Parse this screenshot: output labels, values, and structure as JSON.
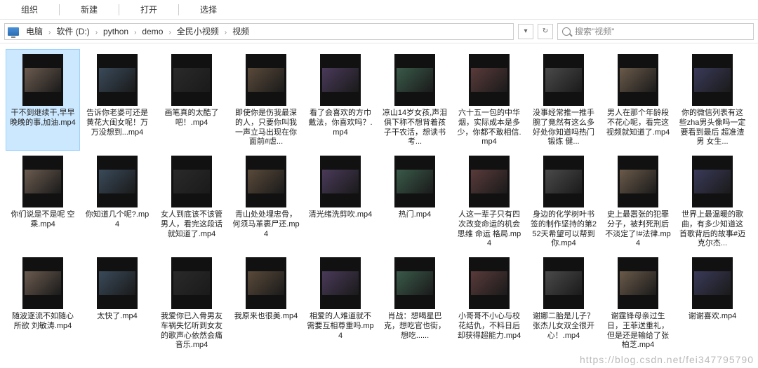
{
  "toolbar": {
    "organize": "组织",
    "new": "新建",
    "open": "打开",
    "select": "选择"
  },
  "breadcrumb": {
    "items": [
      "电脑",
      "软件 (D:)",
      "python",
      "demo",
      "全民小视频",
      "视频"
    ]
  },
  "navbuttons": {
    "refresh": "↻",
    "down": "▾"
  },
  "search": {
    "placeholder": "搜索\"视频\""
  },
  "files": [
    {
      "name": "干不到继续干,早早晚晚的事,加油.mp4",
      "selected": true
    },
    {
      "name": "告诉你老婆可还是黄花大闺女呢！万万没想到...mp4"
    },
    {
      "name": "画笔真的太酷了吧！.mp4"
    },
    {
      "name": "即使你是伤我最深的人，只要你叫我一声立马出现在你面前#虐..."
    },
    {
      "name": "看了会喜欢的方巾戴法，你喜欢吗？.mp4"
    },
    {
      "name": "凉山14岁女孩,声泪俱下称不想背着孩子干农活，想读书考..."
    },
    {
      "name": "六十五一包的中华烟，实际成本是多少，你都不敢相信.mp4"
    },
    {
      "name": "没事经常推一推手腕了竟然有这么多好处你知道吗热门 锻炼 健..."
    },
    {
      "name": "男人在那个年龄段不花心呢，看完这视频就知道了.mp4"
    },
    {
      "name": "你的微信列表有这些zha男头像吗一定要看到最后 超准渣男 女生..."
    },
    {
      "name": "你们说是不是呢 空乘.mp4"
    },
    {
      "name": "你知道几个呢?.mp4"
    },
    {
      "name": "女人到底该不该管男人，看完这段话就知道了.mp4"
    },
    {
      "name": "青山处处埋忠骨，何须马革裹尸还.mp4"
    },
    {
      "name": "清光绪洗剪吹.mp4"
    },
    {
      "name": "热门.mp4"
    },
    {
      "name": "人这一辈子只有四次改变命运的机会思维 命运 格局.mp4"
    },
    {
      "name": "身边的化学树叶书签的制作坚持的第252天希望可以帮到你.mp4"
    },
    {
      "name": "史上最嚣张的犯罪分子，被判死刑后不淡定了!#法律.mp4"
    },
    {
      "name": "世界上最温暖的歌曲，有多少知道这首歌背后的故事#迈克尔杰..."
    },
    {
      "name": "随波逐流不如随心所欲 刘敏涛.mp4"
    },
    {
      "name": "太快了.mp4"
    },
    {
      "name": "我爱你已入骨男友车祸失忆听到女友的歌声心依然会痛音乐.mp4"
    },
    {
      "name": "我原来也很美.mp4"
    },
    {
      "name": "相爱的人难道就不需要互相尊重吗.mp4"
    },
    {
      "name": "肖战：想喝星巴克，想吃官也街，想吃......"
    },
    {
      "name": "小哥哥不小心与校花结仇，不料日后却获得超能力.mp4"
    },
    {
      "name": "谢娜二胎是儿子？张杰儿女双全很开心！.mp4"
    },
    {
      "name": "谢霆锋母亲过生日，王菲送重礼，但是还是输给了张柏芝.mp4"
    },
    {
      "name": "谢谢喜欢.mp4"
    }
  ],
  "watermark": "https://blog.csdn.net/fei347795790"
}
